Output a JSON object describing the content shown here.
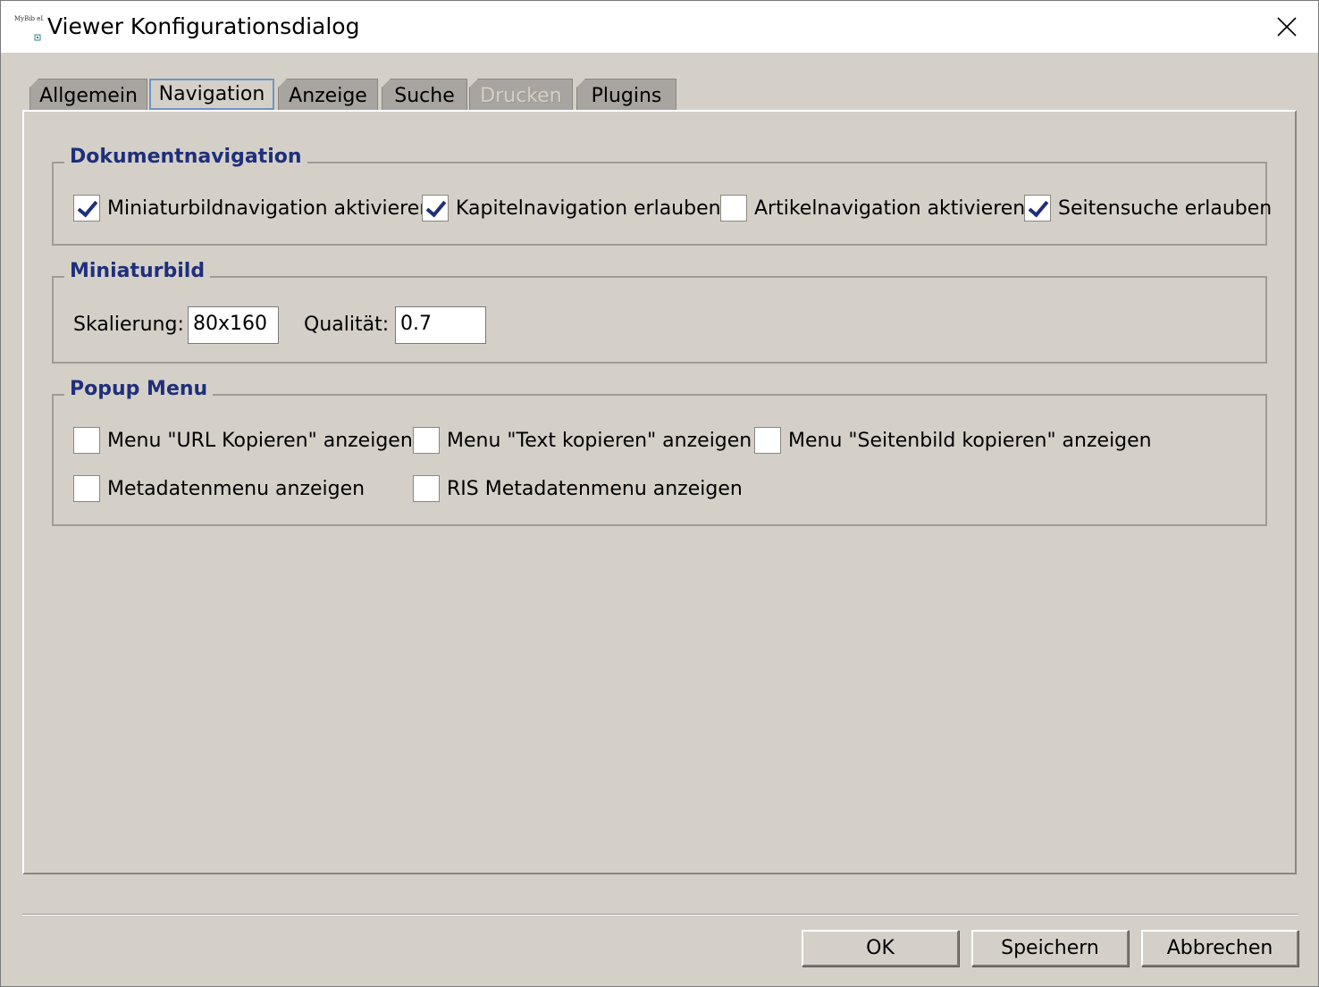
{
  "window": {
    "title": "Viewer Konfigurationsdialog",
    "icon_name": "app-logo-icon",
    "icon_text": "MyBib eL"
  },
  "tabs": [
    {
      "label": "Allgemein",
      "active": false,
      "enabled": true
    },
    {
      "label": "Navigation",
      "active": true,
      "enabled": true
    },
    {
      "label": "Anzeige",
      "active": false,
      "enabled": true
    },
    {
      "label": "Suche",
      "active": false,
      "enabled": true
    },
    {
      "label": "Drucken",
      "active": false,
      "enabled": false
    },
    {
      "label": "Plugins",
      "active": false,
      "enabled": true
    }
  ],
  "dokumentnavigation": {
    "title": "Dokumentnavigation",
    "options": [
      {
        "label": "Miniaturbildnavigation aktivieren",
        "checked": true
      },
      {
        "label": "Kapitelnavigation erlauben",
        "checked": true
      },
      {
        "label": "Artikelnavigation aktivieren",
        "checked": false
      },
      {
        "label": "Seitensuche erlauben",
        "checked": true
      }
    ]
  },
  "miniaturbild": {
    "title": "Miniaturbild",
    "skalierung_label": "Skalierung:",
    "skalierung_value": "80x160",
    "qualitaet_label": "Qualität:",
    "qualitaet_value": "0.7"
  },
  "popup_menu": {
    "title": "Popup Menu",
    "options": [
      {
        "label": "Menu \"URL Kopieren\" anzeigen",
        "checked": false
      },
      {
        "label": "Menu \"Text kopieren\" anzeigen",
        "checked": false
      },
      {
        "label": "Menu \"Seitenbild kopieren\" anzeigen",
        "checked": false
      },
      {
        "label": "Metadatenmenu anzeigen",
        "checked": false
      },
      {
        "label": "RIS Metadatenmenu anzeigen",
        "checked": false
      }
    ]
  },
  "buttons": {
    "ok": "OK",
    "save": "Speichern",
    "cancel": "Abbrechen"
  },
  "colors": {
    "dialog_bg": "#d4d0c8",
    "group_title": "#1f2f7a",
    "check_mark": "#1f2f7a",
    "active_tab_border": "#6f93c8"
  }
}
